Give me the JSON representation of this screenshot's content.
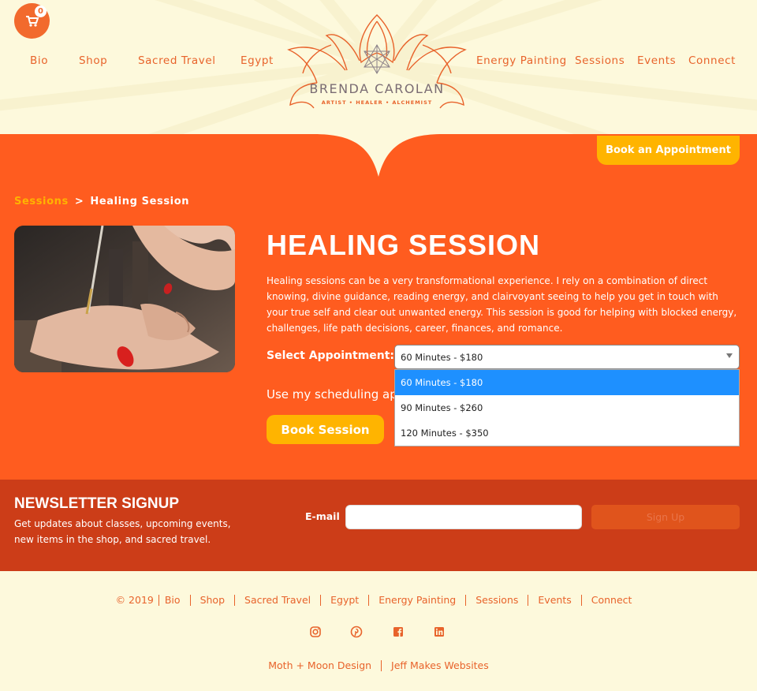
{
  "header": {
    "cart_count": "0",
    "nav_left": [
      "Bio",
      "Shop",
      "Sacred Travel",
      "Egypt"
    ],
    "nav_right": [
      "Energy Painting",
      "Sessions",
      "Events",
      "Connect"
    ],
    "logo_name": "BRENDA CAROLAN",
    "logo_tagline": "ARTIST • HEALER • ALCHEMIST"
  },
  "cta": {
    "book_appointment": "Book an Appointment"
  },
  "breadcrumb": {
    "parent": "Sessions",
    "separator": ">",
    "current": "Healing Session"
  },
  "main": {
    "title": "HEALING SESSION",
    "description": "Healing sessions can be a very transformational experience. I rely on a combination of direct knowing, divine guidance, reading energy, and clairvoyant seeing to help you get in touch with your true self and clear out unwanted energy. This session is good for helping with blocked energy, challenges, life path decisions, career, finances, and romance.",
    "select_label": "Select Appointment:",
    "select_value": "60 Minutes - $180",
    "options": [
      "60 Minutes - $180",
      "90 Minutes - $260",
      "120 Minutes - $350"
    ],
    "scheduling_text": "Use my scheduling app",
    "book_session": "Book Session"
  },
  "newsletter": {
    "title": "NEWSLETTER SIGNUP",
    "description": "Get updates about classes, upcoming events, new items in the shop, and sacred travel.",
    "email_label": "E-mail",
    "signup_label": "Sign Up"
  },
  "footer": {
    "copyright": "© 2019",
    "links": [
      "Bio",
      "Shop",
      "Sacred Travel",
      "Egypt",
      "Energy Painting",
      "Sessions",
      "Events",
      "Connect"
    ],
    "social_icons": [
      "instagram-icon",
      "pinterest-icon",
      "facebook-icon",
      "linkedin-icon"
    ],
    "credits": [
      "Moth + Moon Design",
      "Jeff Makes Websites"
    ]
  },
  "colors": {
    "orange": "#ff5c1f",
    "accent": "#ffb400",
    "dark_orange": "#cc3d18",
    "cream": "#fdf9dc",
    "select_highlight": "#1e90ff"
  }
}
